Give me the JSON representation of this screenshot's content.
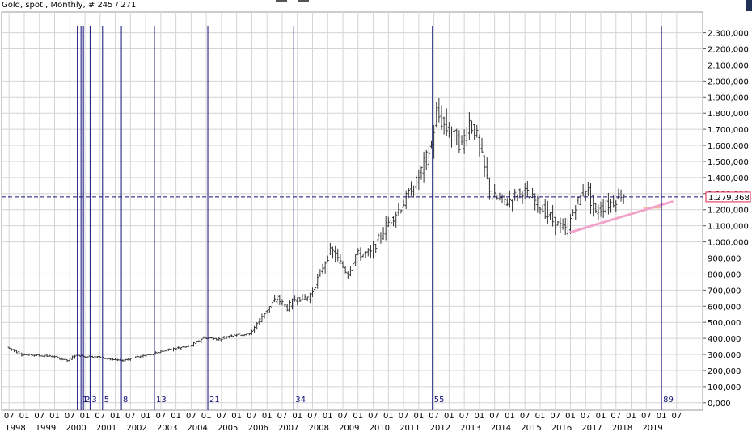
{
  "header": {
    "title": "Gold, spot , Monthly, # 245 / 271"
  },
  "colors": {
    "background": "#ffffff",
    "grid": "#d4d4d4",
    "bars": "#333333",
    "fib_lines": "#101078",
    "price_line": "#101078",
    "trendline": "#f2a3cc",
    "support_line": "#e8a96b",
    "price_label_border": "#e0204c"
  },
  "chart_data": {
    "type": "ohlc",
    "title": "Gold, spot , Monthly, # 245 / 271",
    "y_axis": {
      "range": [
        0,
        2400000
      ],
      "tick_values": [
        0,
        100000,
        200000,
        300000,
        400000,
        500000,
        600000,
        700000,
        800000,
        900000,
        1000000,
        1100000,
        1200000,
        1300000,
        1400000,
        1500000,
        1600000,
        1700000,
        1800000,
        1900000,
        2000000,
        2100000,
        2200000,
        2300000
      ],
      "tick_labels": [
        "0,000",
        "100,000",
        "200,000",
        "300,000",
        "400,000",
        "500,000",
        "600,000",
        "700,000",
        "800,000",
        "900,000",
        "1.000,000",
        "1.100,000",
        "1.200,000",
        "1.300,000",
        "1.400,000",
        "1.500,000",
        "1.600,000",
        "1.700,000",
        "1.800,000",
        "1.900,000",
        "2.000,000",
        "2.100,000",
        "2.200,000",
        "2.300,000"
      ]
    },
    "x_axis": {
      "start": 1997.5,
      "end": 2019.6,
      "month_ticks": [
        {
          "t": 1997.5,
          "label": "07"
        },
        {
          "t": 1998.0,
          "label": "01"
        },
        {
          "t": 1998.5,
          "label": "07"
        },
        {
          "t": 1999.0,
          "label": "01"
        },
        {
          "t": 1999.5,
          "label": "07"
        },
        {
          "t": 2000.0,
          "label": "01"
        },
        {
          "t": 2000.5,
          "label": "07"
        },
        {
          "t": 2001.0,
          "label": "01"
        },
        {
          "t": 2001.5,
          "label": "07"
        },
        {
          "t": 2002.0,
          "label": "01"
        },
        {
          "t": 2002.5,
          "label": "07"
        },
        {
          "t": 2003.0,
          "label": "01"
        },
        {
          "t": 2003.5,
          "label": "07"
        },
        {
          "t": 2004.0,
          "label": "01"
        },
        {
          "t": 2004.5,
          "label": "07"
        },
        {
          "t": 2005.0,
          "label": "01"
        },
        {
          "t": 2005.5,
          "label": "07"
        },
        {
          "t": 2006.0,
          "label": "01"
        },
        {
          "t": 2006.5,
          "label": "07"
        },
        {
          "t": 2007.0,
          "label": "01"
        },
        {
          "t": 2007.5,
          "label": "07"
        },
        {
          "t": 2008.0,
          "label": "01"
        },
        {
          "t": 2008.5,
          "label": "07"
        },
        {
          "t": 2009.0,
          "label": "01"
        },
        {
          "t": 2009.5,
          "label": "07"
        },
        {
          "t": 2010.0,
          "label": "01"
        },
        {
          "t": 2010.5,
          "label": "07"
        },
        {
          "t": 2011.0,
          "label": "01"
        },
        {
          "t": 2011.5,
          "label": "07"
        },
        {
          "t": 2012.0,
          "label": "01"
        },
        {
          "t": 2012.5,
          "label": "07"
        },
        {
          "t": 2013.0,
          "label": "01"
        },
        {
          "t": 2013.5,
          "label": "07"
        },
        {
          "t": 2014.0,
          "label": "01"
        },
        {
          "t": 2014.5,
          "label": "07"
        },
        {
          "t": 2015.0,
          "label": "01"
        },
        {
          "t": 2015.5,
          "label": "07"
        },
        {
          "t": 2016.0,
          "label": "01"
        },
        {
          "t": 2016.5,
          "label": "07"
        },
        {
          "t": 2017.0,
          "label": "01"
        },
        {
          "t": 2017.5,
          "label": "07"
        },
        {
          "t": 2018.0,
          "label": "01"
        },
        {
          "t": 2018.5,
          "label": "07"
        },
        {
          "t": 2019.0,
          "label": "01"
        },
        {
          "t": 2019.5,
          "label": "07"
        }
      ],
      "year_labels": [
        {
          "t": 1998.0,
          "label": "1998"
        },
        {
          "t": 1999.0,
          "label": "1999"
        },
        {
          "t": 2000.0,
          "label": "2000"
        },
        {
          "t": 2001.0,
          "label": "2001"
        },
        {
          "t": 2002.0,
          "label": "2002"
        },
        {
          "t": 2003.0,
          "label": "2003"
        },
        {
          "t": 2004.0,
          "label": "2004"
        },
        {
          "t": 2005.0,
          "label": "2005"
        },
        {
          "t": 2006.0,
          "label": "2006"
        },
        {
          "t": 2007.0,
          "label": "2007"
        },
        {
          "t": 2008.0,
          "label": "2008"
        },
        {
          "t": 2009.0,
          "label": "2009"
        },
        {
          "t": 2010.0,
          "label": "2010"
        },
        {
          "t": 2011.0,
          "label": "2011"
        },
        {
          "t": 2012.0,
          "label": "2012"
        },
        {
          "t": 2013.0,
          "label": "2013"
        },
        {
          "t": 2014.0,
          "label": "2014"
        },
        {
          "t": 2015.0,
          "label": "2015"
        },
        {
          "t": 2016.0,
          "label": "2016"
        },
        {
          "t": 2017.0,
          "label": "2017"
        },
        {
          "t": 2018.0,
          "label": "2018"
        },
        {
          "t": 2019.0,
          "label": "2019"
        }
      ]
    },
    "fibonacci_time_lines": [
      {
        "label": "",
        "t": 1999.75
      },
      {
        "label": "1",
        "t": 1999.87
      },
      {
        "label": "2",
        "t": 1999.95
      },
      {
        "label": "3",
        "t": 2000.17
      },
      {
        "label": "5",
        "t": 2000.58
      },
      {
        "label": "8",
        "t": 2001.2
      },
      {
        "label": "13",
        "t": 2002.29
      },
      {
        "label": "21",
        "t": 2004.05
      },
      {
        "label": "34",
        "t": 2006.88
      },
      {
        "label": "55",
        "t": 2011.45
      },
      {
        "label": "89",
        "t": 2019.0
      }
    ],
    "price_line": {
      "value": 1279368,
      "label": "1.279,368"
    },
    "trendline": {
      "from": {
        "t": 2016.0,
        "value": 1060000
      },
      "to": {
        "t": 2019.35,
        "value": 1250000
      }
    },
    "support_line": {
      "from": {
        "t": 2018.4,
        "value": 1210000
      },
      "to": {
        "t": 2019.0,
        "value": 1210000
      }
    },
    "anchors": [
      {
        "t": 1997.5,
        "value": 345000
      },
      {
        "t": 1998.0,
        "value": 300000
      },
      {
        "t": 1998.5,
        "value": 295000
      },
      {
        "t": 1999.0,
        "value": 288000
      },
      {
        "t": 1999.5,
        "value": 262000
      },
      {
        "t": 1999.8,
        "value": 300000
      },
      {
        "t": 2000.0,
        "value": 288000
      },
      {
        "t": 2000.5,
        "value": 285000
      },
      {
        "t": 2001.0,
        "value": 268000
      },
      {
        "t": 2001.3,
        "value": 262000
      },
      {
        "t": 2001.75,
        "value": 285000
      },
      {
        "t": 2002.0,
        "value": 290000
      },
      {
        "t": 2002.5,
        "value": 315000
      },
      {
        "t": 2003.0,
        "value": 335000
      },
      {
        "t": 2003.5,
        "value": 350000
      },
      {
        "t": 2004.0,
        "value": 405000
      },
      {
        "t": 2004.5,
        "value": 395000
      },
      {
        "t": 2005.0,
        "value": 425000
      },
      {
        "t": 2005.5,
        "value": 425000
      },
      {
        "t": 2006.0,
        "value": 560000
      },
      {
        "t": 2006.4,
        "value": 650000
      },
      {
        "t": 2006.75,
        "value": 590000
      },
      {
        "t": 2007.0,
        "value": 645000
      },
      {
        "t": 2007.5,
        "value": 660000
      },
      {
        "t": 2008.0,
        "value": 880000
      },
      {
        "t": 2008.2,
        "value": 950000
      },
      {
        "t": 2008.75,
        "value": 800000
      },
      {
        "t": 2009.0,
        "value": 920000
      },
      {
        "t": 2009.5,
        "value": 930000
      },
      {
        "t": 2010.0,
        "value": 1100000
      },
      {
        "t": 2010.5,
        "value": 1220000
      },
      {
        "t": 2011.0,
        "value": 1370000
      },
      {
        "t": 2011.5,
        "value": 1600000
      },
      {
        "t": 2011.67,
        "value": 1800000
      },
      {
        "t": 2012.0,
        "value": 1700000
      },
      {
        "t": 2012.5,
        "value": 1600000
      },
      {
        "t": 2012.75,
        "value": 1750000
      },
      {
        "t": 2013.0,
        "value": 1650000
      },
      {
        "t": 2013.25,
        "value": 1450000
      },
      {
        "t": 2013.5,
        "value": 1280000
      },
      {
        "t": 2014.0,
        "value": 1250000
      },
      {
        "t": 2014.5,
        "value": 1320000
      },
      {
        "t": 2015.0,
        "value": 1240000
      },
      {
        "t": 2015.5,
        "value": 1130000
      },
      {
        "t": 2015.95,
        "value": 1070000
      },
      {
        "t": 2016.25,
        "value": 1230000
      },
      {
        "t": 2016.6,
        "value": 1340000
      },
      {
        "t": 2016.9,
        "value": 1170000
      },
      {
        "t": 2017.0,
        "value": 1200000
      },
      {
        "t": 2017.5,
        "value": 1250000
      },
      {
        "t": 2017.75,
        "value": 1300000
      }
    ],
    "grid": true,
    "legend": "none"
  }
}
